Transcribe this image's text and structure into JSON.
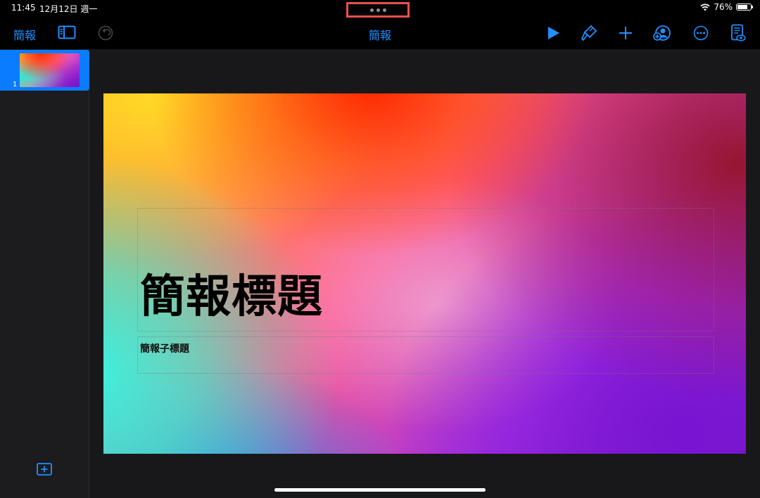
{
  "status_bar": {
    "time": "11:45",
    "date": "12月12日 週一",
    "battery_percent": "76%",
    "battery_level": 0.76
  },
  "toolbar": {
    "back_label": "簡報",
    "document_title": "簡報",
    "icons": [
      "sidebar-toggle-icon",
      "undo-icon",
      "play-icon",
      "format-brush-icon",
      "add-icon",
      "collaborate-icon",
      "more-icon",
      "reading-view-icon"
    ]
  },
  "sidebar": {
    "slides": [
      {
        "number": "1"
      }
    ]
  },
  "slide": {
    "title": "簡報標題",
    "subtitle": "簡報子標題"
  },
  "colors": {
    "accent": "#1e90ff",
    "selection": "#0a7cff",
    "highlight": "#e8514a"
  }
}
